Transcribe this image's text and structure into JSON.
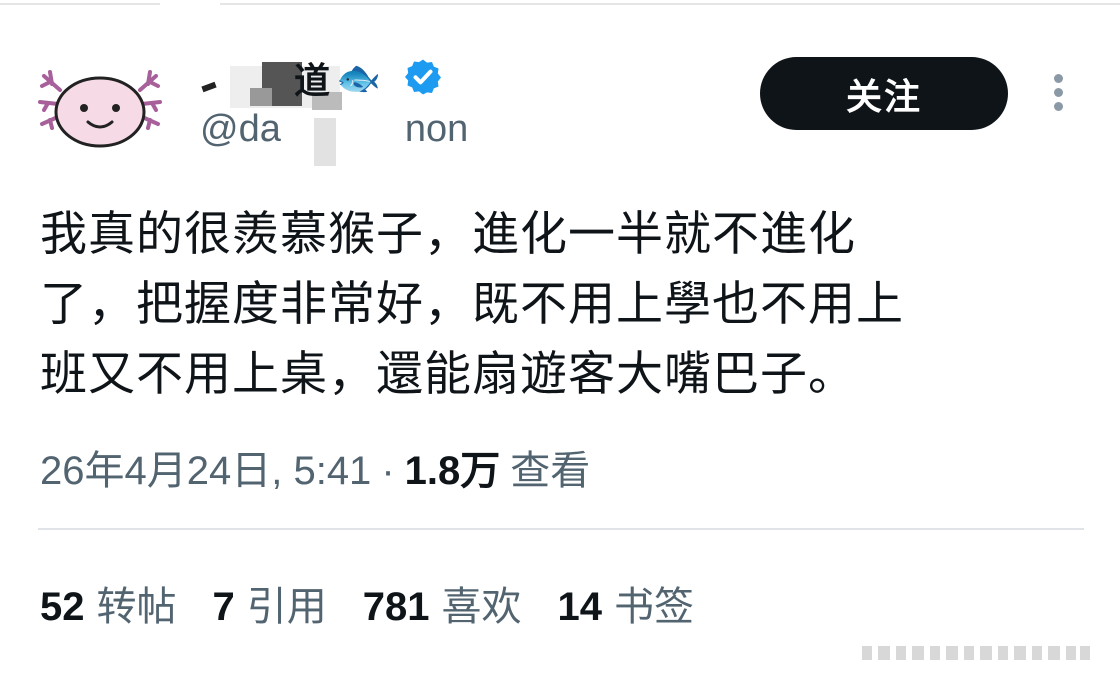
{
  "user": {
    "display_name_visible": "道",
    "display_emoji": "🐟",
    "handle_visible_start": "@da",
    "handle_visible_end": "non",
    "verified": true
  },
  "follow_button": {
    "label": "关注"
  },
  "tweet": {
    "lines": [
      "我真的很羨慕猴子，進化一半就不進化",
      "了，把握度非常好，既不用上學也不用上",
      "班又不用上桌，還能扇遊客大嘴巴子。"
    ]
  },
  "meta": {
    "date_time": "26年4月24日, 5:41",
    "separator": "·",
    "views_count": "1.8万",
    "views_label": "查看"
  },
  "stats": [
    {
      "count": "52",
      "label": "转帖"
    },
    {
      "count": "7",
      "label": "引用"
    },
    {
      "count": "781",
      "label": "喜欢"
    },
    {
      "count": "14",
      "label": "书签"
    }
  ],
  "colors": {
    "text_primary": "#0f1419",
    "text_secondary": "#536471",
    "verified_blue": "#1d9bf0",
    "button_bg": "#0f1419"
  }
}
